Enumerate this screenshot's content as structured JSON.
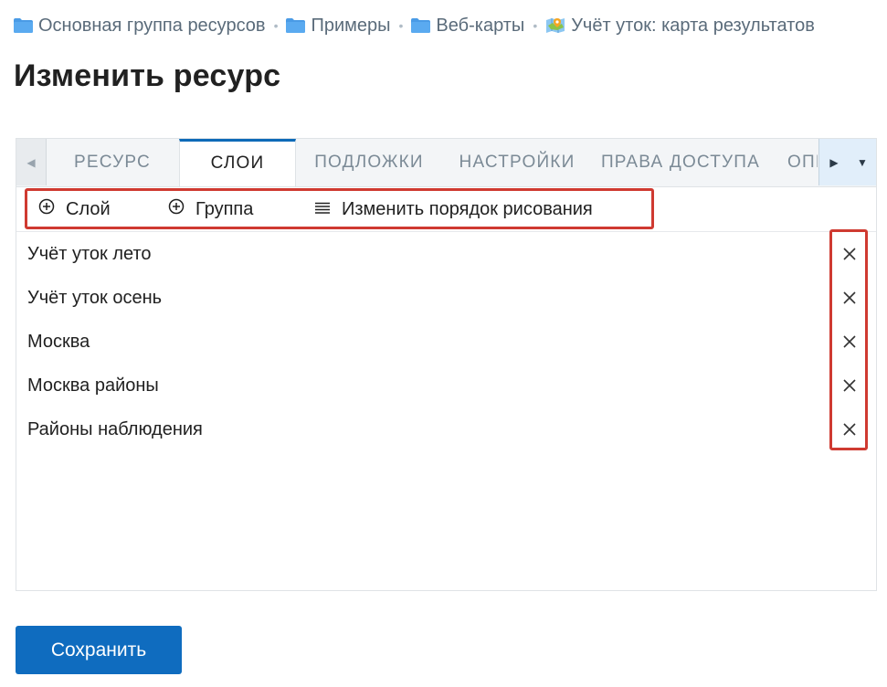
{
  "breadcrumb": [
    {
      "label": "Основная группа ресурсов",
      "icon": "folder-icon"
    },
    {
      "label": "Примеры",
      "icon": "folder-icon"
    },
    {
      "label": "Веб-карты",
      "icon": "folder-icon"
    },
    {
      "label": "Учёт уток: карта результатов",
      "icon": "webmap-icon"
    }
  ],
  "breadcrumb_separator": "•",
  "page": {
    "title": "Изменить ресурс"
  },
  "tabs": [
    {
      "label": "РЕСУРС",
      "active": false
    },
    {
      "label": "СЛОИ",
      "active": true
    },
    {
      "label": "ПОДЛОЖКИ",
      "active": false
    },
    {
      "label": "НАСТРОЙКИ",
      "active": false
    },
    {
      "label": "ПРАВА ДОСТУПА",
      "active": false
    },
    {
      "label": "ОПИСАНИЕ",
      "active": false
    }
  ],
  "toolbar": {
    "add_layer_label": "Слой",
    "add_group_label": "Группа",
    "reorder_label": "Изменить порядок рисования"
  },
  "layers": [
    {
      "name": "Учёт уток лето"
    },
    {
      "name": "Учёт уток осень"
    },
    {
      "name": "Москва"
    },
    {
      "name": "Москва районы"
    },
    {
      "name": "Районы наблюдения"
    }
  ],
  "save_label": "Сохранить",
  "colors": {
    "accent": "#0f6cbf",
    "highlight": "#cf3a31",
    "folder": "#4a9be6"
  }
}
